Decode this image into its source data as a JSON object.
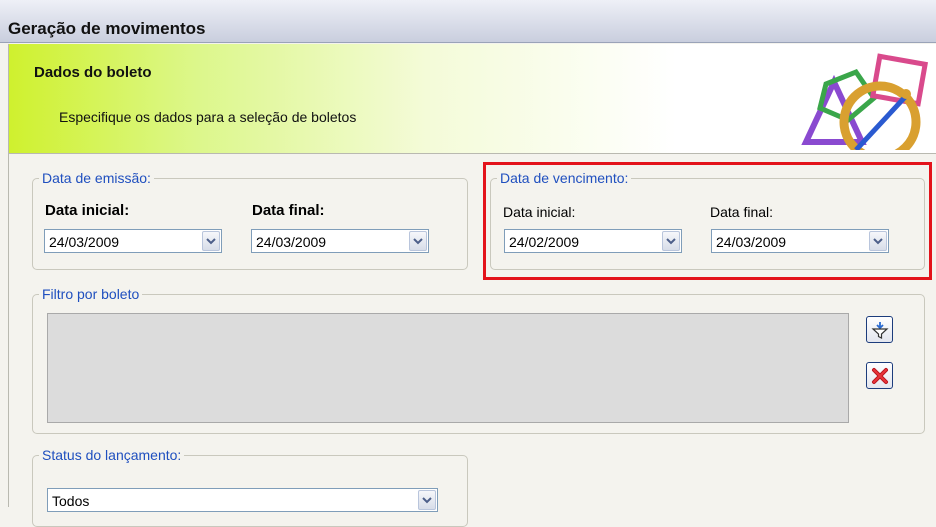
{
  "window": {
    "title": "Geração de movimentos"
  },
  "banner": {
    "heading": "Dados do boleto",
    "subtitle": "Especifique os dados para a seleção de boletos"
  },
  "emissao": {
    "legend": "Data de emissão:",
    "inicial_label": "Data inicial:",
    "inicial_value": "24/03/2009",
    "final_label": "Data final:",
    "final_value": "24/03/2009"
  },
  "vencimento": {
    "legend": "Data de vencimento:",
    "inicial_label": "Data inicial:",
    "inicial_value": "24/02/2009",
    "final_label": "Data final:",
    "final_value": "24/03/2009",
    "highlight_color": "#e3131b"
  },
  "filtro": {
    "legend": "Filtro por boleto",
    "add_filter_icon": "filter-add-icon",
    "remove_filter_icon": "red-x-icon"
  },
  "status": {
    "legend": "Status do lançamento:",
    "value": "Todos"
  },
  "colors": {
    "legend_text": "#1f4fbf",
    "banner_accent": "#cff12e"
  }
}
